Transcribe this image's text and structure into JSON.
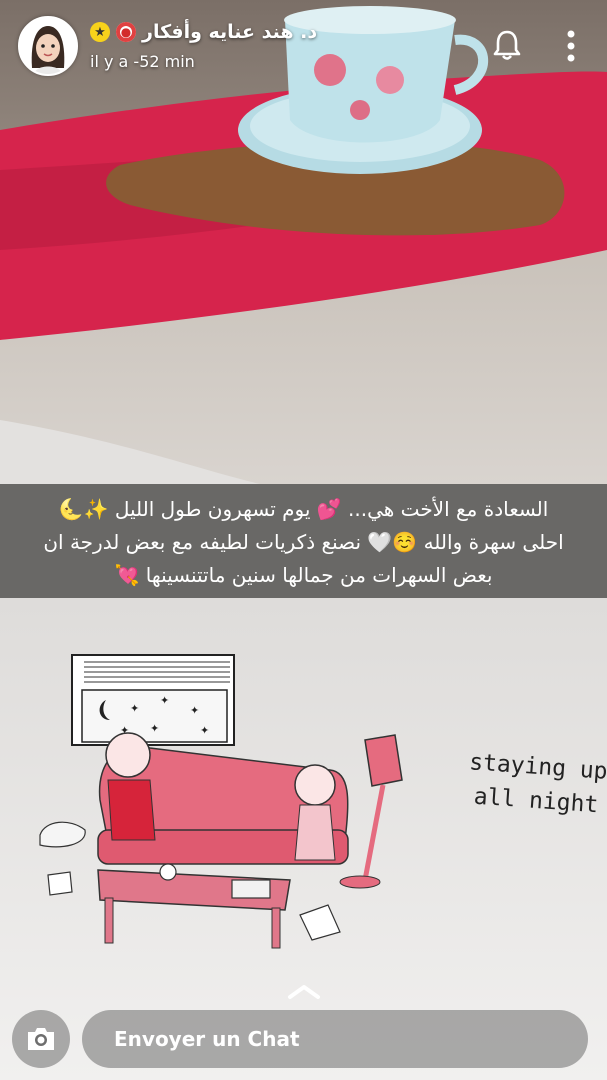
{
  "story": {
    "title": "د. هند عنايه وأفكار",
    "timestamp": "il y a -52 min",
    "title_badges": [
      "target-emoji",
      "star-badge"
    ]
  },
  "caption": {
    "lines": [
      "السعادة مع الأخت هي... 💕 يوم تسهرون طول الليل ✨🌜",
      "احلى سهرة والله ☺️🤍 نصنع ذكريات لطيفه مع بعض لدرجة ان",
      "بعض السهرات من جمالها سنين ماتتنسينها 💘"
    ]
  },
  "illustration": {
    "handwritten_text_line1": "staying up",
    "handwritten_text_line2": "all night"
  },
  "bottom_bar": {
    "chat_placeholder": "Envoyer un Chat"
  },
  "icons": {
    "bell": "bell-icon",
    "more": "more-vertical-icon",
    "camera": "camera-icon",
    "swipe_up": "chevron-up-icon"
  },
  "colors": {
    "blanket": "#d6244c",
    "couch": "#e56b7f",
    "page": "#eeeeee"
  }
}
